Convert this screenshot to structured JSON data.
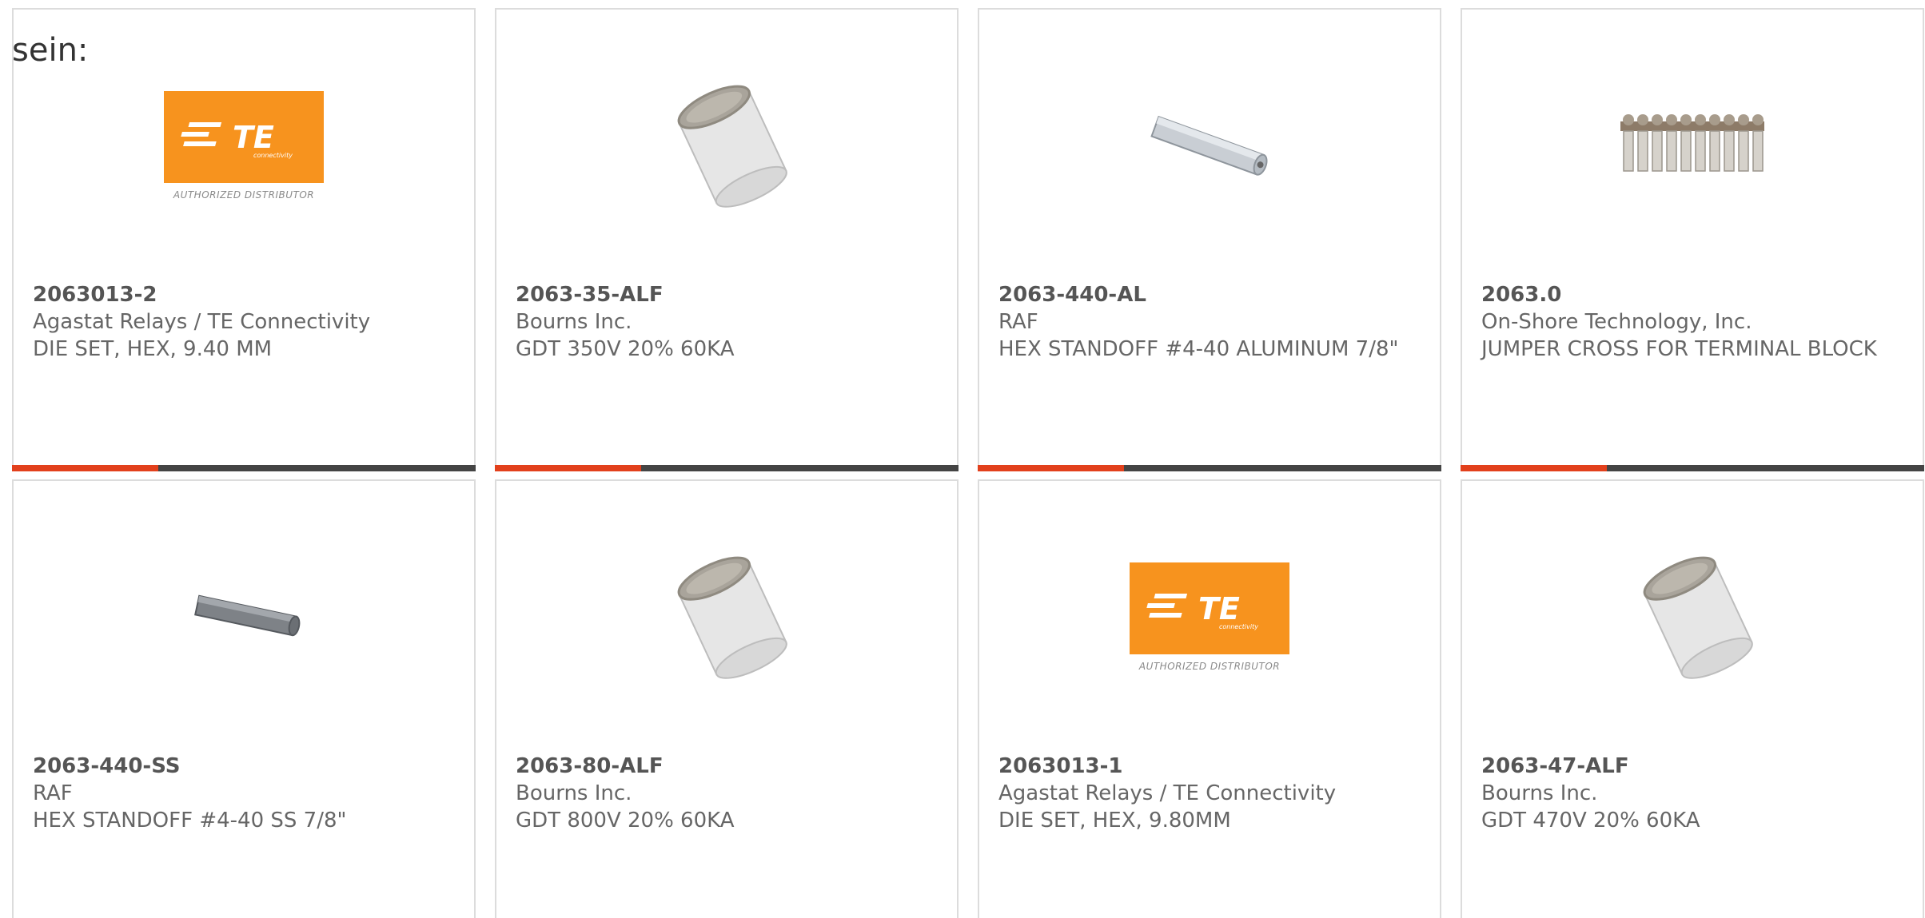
{
  "overlay_text": "sein:",
  "products": [
    {
      "part": "2063013-2",
      "manufacturer": "Agastat Relays / TE Connectivity",
      "description": "DIE SET, HEX, 9.40 MM",
      "image": "te-logo",
      "logo_caption": "AUTHORIZED DISTRIBUTOR"
    },
    {
      "part": "2063-35-ALF",
      "manufacturer": "Bourns Inc.",
      "description": "GDT 350V 20% 60KA",
      "image": "gas-discharge-tube"
    },
    {
      "part": "2063-440-AL",
      "manufacturer": "RAF",
      "description": "HEX STANDOFF #4-40 ALUMINUM 7/8\"",
      "image": "hex-standoff-aluminum"
    },
    {
      "part": "2063.0",
      "manufacturer": "On-Shore Technology, Inc.",
      "description": "JUMPER CROSS FOR TERMINAL BLOCK",
      "image": "jumper-cross"
    },
    {
      "part": "2063-440-SS",
      "manufacturer": "RAF",
      "description": "HEX STANDOFF #4-40 SS 7/8\"",
      "image": "hex-standoff-steel"
    },
    {
      "part": "2063-80-ALF",
      "manufacturer": "Bourns Inc.",
      "description": "GDT 800V 20% 60KA",
      "image": "gas-discharge-tube"
    },
    {
      "part": "2063013-1",
      "manufacturer": "Agastat Relays / TE Connectivity",
      "description": "DIE SET, HEX, 9.80MM",
      "image": "te-logo",
      "logo_caption": "AUTHORIZED DISTRIBUTOR"
    },
    {
      "part": "2063-47-ALF",
      "manufacturer": "Bourns Inc.",
      "description": "GDT 470V 20% 60KA",
      "image": "gas-discharge-tube"
    }
  ],
  "colors": {
    "accent": "#e2401c",
    "bar": "#444444",
    "te_orange": "#f7931e",
    "text": "#666666",
    "border": "#dcdcdc"
  }
}
